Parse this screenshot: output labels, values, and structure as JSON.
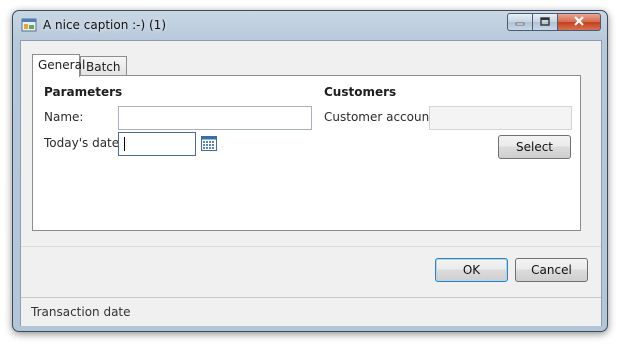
{
  "window": {
    "title": "A nice caption :-) (1)",
    "icon": "app-window-icon",
    "controls": {
      "minimize": "minimize-icon",
      "maximize": "maximize-icon",
      "close": "close-icon"
    }
  },
  "tabs": [
    {
      "label": "General",
      "active": true
    },
    {
      "label": "Batch",
      "active": false
    }
  ],
  "parameters": {
    "heading": "Parameters",
    "name_label": "Name:",
    "name_value": "",
    "date_label": "Today's date:",
    "date_value": "",
    "calendar_icon": "calendar-icon"
  },
  "customers": {
    "heading": "Customers",
    "account_label": "Customer account:",
    "account_value": "",
    "select_label": "Select"
  },
  "buttons": {
    "ok": "OK",
    "cancel": "Cancel"
  },
  "status": {
    "text": "Transaction date"
  },
  "colors": {
    "default_button_border": "#3c7fb1",
    "window_frame": "#b6c8da"
  }
}
